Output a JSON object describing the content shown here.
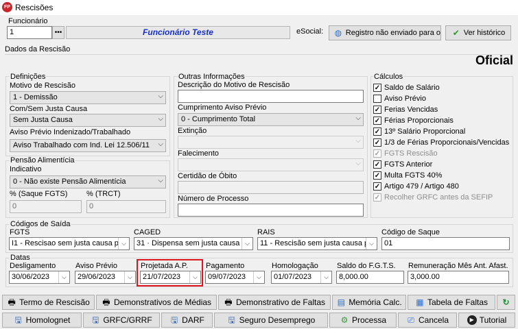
{
  "window": {
    "title": "Rescisões",
    "icon_text": "FP"
  },
  "funcionario": {
    "label": "Funcionário",
    "code": "1",
    "name": "Funcionário Teste",
    "esocial_label": "eSocial:",
    "esocial_button": "Registro não enviado para o",
    "historico_button": "Ver histórico"
  },
  "dados_label": "Dados da Rescisão",
  "oficial": "Oficial",
  "definicoes": {
    "title": "Definições",
    "motivo_label": "Motivo de Rescisão",
    "motivo": "1 - Demissão",
    "justa_label": "Com/Sem Justa Causa",
    "justa": "Sem Justa Causa",
    "aviso_label": "Aviso Prévio Indenizado/Trabalhado",
    "aviso": "Aviso Trabalhado com Ind. Lei 12.506/11"
  },
  "pensao": {
    "title": "Pensão Alimentícia",
    "indicativo_label": "Indicativo",
    "indicativo": "0 - Não existe Pensão Alimentícia",
    "saque_label": "% (Saque FGTS)",
    "saque": "0",
    "trct_label": "% (TRCT)",
    "trct": "0"
  },
  "outras": {
    "title": "Outras Informações",
    "descricao_label": "Descrição do Motivo de Rescisão",
    "descricao": "",
    "cumprimento_label": "Cumprimento Aviso Prévio",
    "cumprimento": "0 - Cumprimento Total",
    "extincao_label": "Extinção",
    "falecimento_label": "Falecimento",
    "certidao_label": "Certidão de Óbito",
    "processo_label": "Número de Processo",
    "processo": ""
  },
  "calculos": {
    "title": "Cálculos",
    "items": [
      {
        "label": "Saldo de Salário",
        "checked": true,
        "disabled": false
      },
      {
        "label": "Aviso Prévio",
        "checked": false,
        "disabled": false
      },
      {
        "label": "Ferias Vencidas",
        "checked": true,
        "disabled": false
      },
      {
        "label": "Férias Proporcionais",
        "checked": true,
        "disabled": false
      },
      {
        "label": "13º Salário Proporcional",
        "checked": true,
        "disabled": false
      },
      {
        "label": "1/3 de Férias Proporcionais/Vencidas",
        "checked": true,
        "disabled": false
      },
      {
        "label": "FGTS Rescisão",
        "checked": true,
        "disabled": true
      },
      {
        "label": "FGTS Anterior",
        "checked": true,
        "disabled": false
      },
      {
        "label": "Multa FGTS 40%",
        "checked": true,
        "disabled": false
      },
      {
        "label": "Artigo 479 / Artigo 480",
        "checked": true,
        "disabled": false
      },
      {
        "label": "Recolher GRFC antes da SEFIP",
        "checked": true,
        "disabled": true
      }
    ]
  },
  "codigos": {
    "title": "Códigos de Saída",
    "fgts_label": "FGTS",
    "fgts": "I1 - Rescisao sem justa causa po",
    "caged_label": "CAGED",
    "caged": "31  ·  Dispensa sem justa causa",
    "rais_label": "RAIS",
    "rais": "11 - Rescisão sem justa causa p",
    "saque_label": "Código de Saque",
    "saque": "01"
  },
  "datas": {
    "title": "Datas",
    "deslig_label": "Desligamento",
    "deslig": "30/06/2023",
    "aviso_label": "Aviso Prévio",
    "aviso": "29/06/2023",
    "projetada_label": "Projetada A.P.",
    "projetada": "21/07/2023",
    "pagamento_label": "Pagamento",
    "pagamento": "09/07/2023",
    "homolog_label": "Homologação",
    "homolog": "01/07/2023",
    "saldo_label": "Saldo do F.G.T.S.",
    "saldo": "8,000.00",
    "remun_label": "Remuneração Mês Ant. Afast.",
    "remun": "3,000.00"
  },
  "buttons_row1": {
    "termo": "Termo de Rescisão",
    "medias": "Demonstrativos de Médias",
    "faltas": "Demonstrativo de Faltas",
    "memoria": "Memória Calc.",
    "tabela": "Tabela de Faltas"
  },
  "buttons_row2": {
    "homolognet": "Homolognet",
    "grfc": "GRFC/GRRF",
    "darf": "DARF",
    "seguro": "Seguro Desemprego",
    "processa": "Processa",
    "cancela": "Cancela",
    "tutorial": "Tutorial"
  }
}
